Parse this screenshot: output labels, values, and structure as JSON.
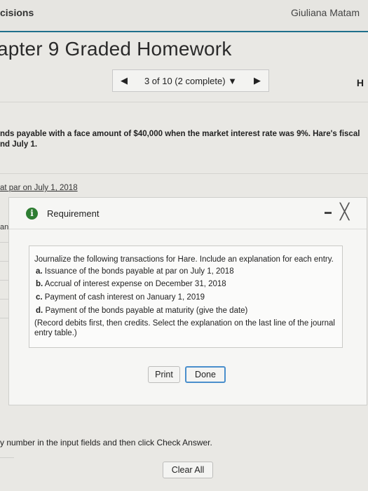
{
  "header": {
    "breadcrumb": "cisions",
    "user_name": "Giuliana Matam"
  },
  "page_title": "apter 9 Graded Homework",
  "nav": {
    "prev_icon": "◀",
    "counter": "3 of 10 (2 complete) ▼",
    "next_icon": "▶",
    "help_label": "H"
  },
  "question_text": "nds payable with a face amount of $40,000 when the market interest rate was 9%. Hare's fiscal\nnd July 1.",
  "partial_link": "at par on July 1, 2018",
  "partial_label": "an",
  "modal": {
    "info_icon": "i",
    "title": "Requirement",
    "close_icon": "╳",
    "intro": "Journalize the following transactions for Hare. Include an explanation for each entry.",
    "items": [
      {
        "letter": "a.",
        "text": "Issuance of the bonds payable at par on July 1, 2018"
      },
      {
        "letter": "b.",
        "text": "Accrual of interest expense on December 31, 2018"
      },
      {
        "letter": "c.",
        "text": "Payment of cash interest on January 1, 2019"
      },
      {
        "letter": "d.",
        "text": "Payment of the bonds payable at maturity (give the date)"
      }
    ],
    "note": "(Record debits first, then credits. Select the explanation on the last line of the journal entry table.)",
    "print_label": "Print",
    "done_label": "Done"
  },
  "bottom": {
    "instruction": "y number in the input fields and then click Check Answer.",
    "clear_label": "Clear All"
  }
}
